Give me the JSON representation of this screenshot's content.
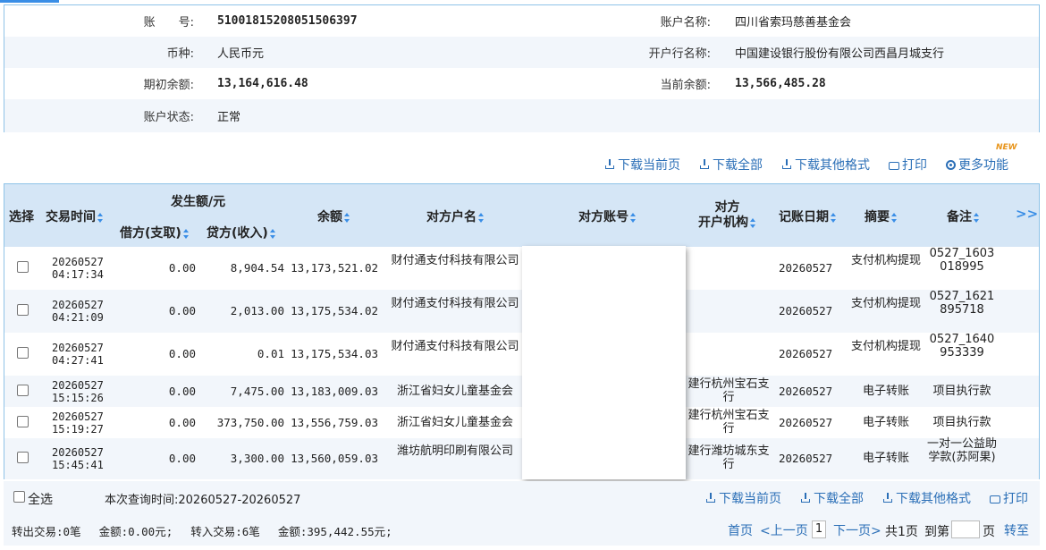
{
  "account": {
    "number_label": "账　　号:",
    "number": "5100181520805150639 7",
    "name_label": "账户名称:",
    "name": "四川省索玛慈善基金会",
    "currency_label": "币种:",
    "currency": "人民币元",
    "bank_label": "开户行名称:",
    "bank": "中国建设银行股份有限公司西昌月城支行",
    "opening_balance_label": "期初余额:",
    "opening_balance": "13,164,616.48",
    "current_balance_label": "当前余额:",
    "current_balance": "13,566,485.28",
    "status_label": "账户状态:",
    "status": "正常"
  },
  "toolbar": {
    "download_page": "下载当前页",
    "download_all": "下载全部",
    "download_other": "下载其他格式",
    "print": "打印",
    "more": "更多功能",
    "new_badge": "NEW"
  },
  "table": {
    "headers": {
      "select": "选择",
      "time": "交易时间",
      "amount_group": "发生额/元",
      "debit": "借方(支取)",
      "credit": "贷方(收入)",
      "balance": "余额",
      "counterparty_name": "对方户名",
      "counterparty_account": "对方账号",
      "counterparty_bank_1": "对方",
      "counterparty_bank_2": "开户机构",
      "post_date": "记账日期",
      "summary": "摘要",
      "remark": "备注",
      "expand": ">>"
    },
    "rows": [
      {
        "date": "20260527",
        "time": "04:17:34",
        "debit": "0.00",
        "credit": "8,904.54",
        "balance": "13,173,521.02",
        "name": "财付通支付科技有限公司",
        "bank": "",
        "post_date": "20260527",
        "summary": "支付机构提现",
        "remark": "0527_1603018995"
      },
      {
        "date": "20260527",
        "time": "04:21:09",
        "debit": "0.00",
        "credit": "2,013.00",
        "balance": "13,175,534.02",
        "name": "财付通支付科技有限公司",
        "bank": "",
        "post_date": "20260527",
        "summary": "支付机构提现",
        "remark": "0527_1621895718"
      },
      {
        "date": "20260527",
        "time": "04:27:41",
        "debit": "0.00",
        "credit": "0.01",
        "balance": "13,175,534.03",
        "name": "财付通支付科技有限公司",
        "bank": "",
        "post_date": "20260527",
        "summary": "支付机构提现",
        "remark": "0527_1640953339"
      },
      {
        "date": "20260527",
        "time": "15:15:26",
        "debit": "0.00",
        "credit": "7,475.00",
        "balance": "13,183,009.03",
        "name": "浙江省妇女儿童基金会",
        "bank": "建行杭州宝石支行",
        "post_date": "20260527",
        "summary": "电子转账",
        "remark": "项目执行款"
      },
      {
        "date": "20260527",
        "time": "15:19:27",
        "debit": "0.00",
        "credit": "373,750.00",
        "balance": "13,556,759.03",
        "name": "浙江省妇女儿童基金会",
        "bank": "建行杭州宝石支行",
        "post_date": "20260527",
        "summary": "电子转账",
        "remark": "项目执行款"
      },
      {
        "date": "20260527",
        "time": "15:45:41",
        "debit": "0.00",
        "credit": "3,300.00",
        "balance": "13,560,059.03",
        "name": "潍坊航明印刷有限公司",
        "bank": "建行潍坊城东支行",
        "post_date": "20260527",
        "summary": "电子转账",
        "remark": "一对一公益助学款(苏阿果)"
      }
    ]
  },
  "footer": {
    "select_all": "全选",
    "query_time": "本次查询时间:20260527-20260527",
    "download_page": "下载当前页",
    "download_all": "下载全部",
    "download_other": "下载其他格式",
    "print": "打印",
    "summary": "转出交易:0笔　 金额:0.00元;　 转入交易:6笔　 金额:395,442.55元;",
    "first": "首页",
    "prev": "<上一页",
    "page": "1",
    "next": "下一页>",
    "total": "共1页",
    "goto": "到第",
    "page_unit": "页",
    "go": "转至"
  }
}
